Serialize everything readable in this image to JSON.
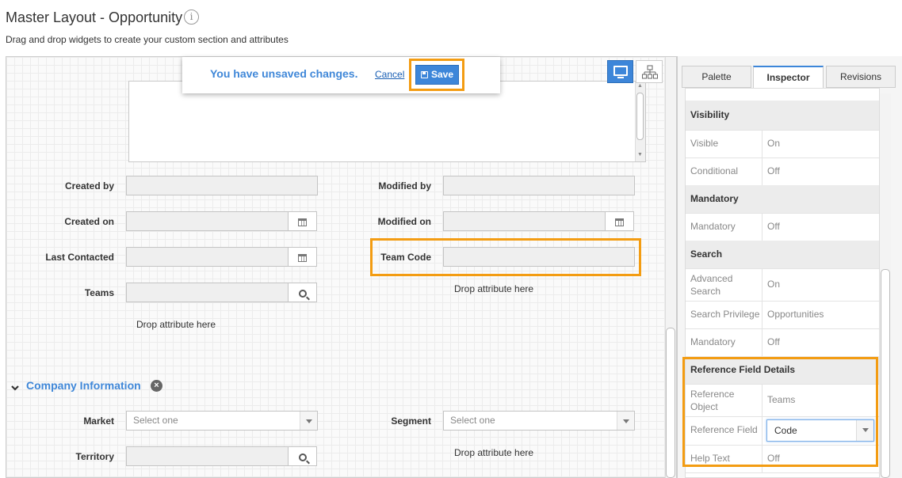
{
  "header": {
    "title": "Master Layout - Opportunity",
    "info_glyph": "i",
    "subtitle": "Drag and drop widgets to create your custom section and attributes"
  },
  "banner": {
    "message": "You have unsaved changes.",
    "cancel_label": "Cancel",
    "save_label": "Save"
  },
  "fields_left": [
    {
      "label": "Created by"
    },
    {
      "label": "Created on",
      "addon": "calendar-icon"
    },
    {
      "label": "Last Contacted",
      "addon": "calendar-icon"
    },
    {
      "label": "Teams",
      "addon": "search-icon"
    }
  ],
  "fields_right": [
    {
      "label": "Modified by"
    },
    {
      "label": "Modified on",
      "addon": "calendar-icon"
    },
    {
      "label": "Team Code"
    }
  ],
  "drop_attribute_text": "Drop attribute here",
  "company_section": {
    "title": "Company Information",
    "remove_glyph": "×",
    "market_label": "Market",
    "market_placeholder": "Select one",
    "segment_label": "Segment",
    "segment_placeholder": "Select one",
    "territory_label": "Territory"
  },
  "panel": {
    "tabs": [
      "Palette",
      "Inspector",
      "Revisions"
    ],
    "active_tab": "Inspector",
    "inspector": {
      "visibility_header": "Visibility",
      "visible_key": "Visible",
      "visible_val": "On",
      "conditional_key": "Conditional",
      "conditional_val": "Off",
      "mandatory_header": "Mandatory",
      "mandatory_key": "Mandatory",
      "mandatory_val": "Off",
      "search_header": "Search",
      "adv_search_key_1": "Advanced",
      "adv_search_key_2": "Search",
      "adv_search_val": "On",
      "search_priv_key": "Search Privilege",
      "search_priv_val": "Opportunities",
      "search_mand_key": "Mandatory",
      "search_mand_val": "Off",
      "ref_header": "Reference Field Details",
      "ref_obj_key_1": "Reference",
      "ref_obj_key_2": "Object",
      "ref_obj_val": "Teams",
      "ref_field_key": "Reference Field",
      "ref_field_val": "Code",
      "help_key": "Help Text",
      "help_val": "Off"
    }
  },
  "colors": {
    "accent": "#3d86d9",
    "highlight_outline": "#f39c12",
    "section_title": "#3f87d8"
  }
}
